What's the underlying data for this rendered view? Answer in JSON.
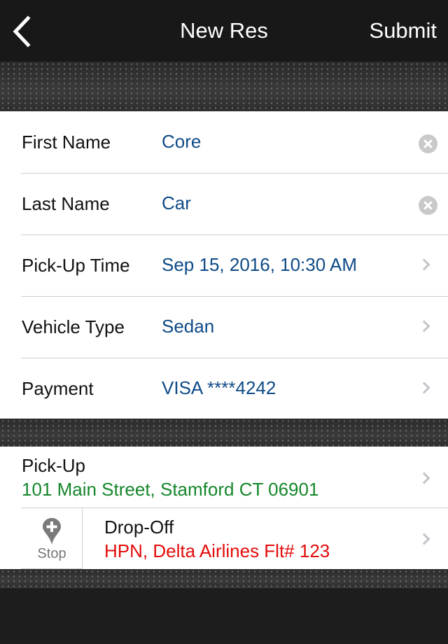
{
  "nav": {
    "title": "New Res",
    "submit_label": "Submit"
  },
  "details": [
    {
      "label": "First Name",
      "value": "Core",
      "action": "clear"
    },
    {
      "label": "Last Name",
      "value": "Car",
      "action": "clear"
    },
    {
      "label": "Pick-Up Time",
      "value": "Sep 15, 2016, 10:30 AM",
      "action": "chevron"
    },
    {
      "label": "Vehicle Type",
      "value": "Sedan",
      "action": "chevron"
    },
    {
      "label": "Payment",
      "value": "VISA ****4242",
      "action": "chevron"
    }
  ],
  "locations": {
    "pickup": {
      "title": "Pick-Up",
      "address": "101 Main Street, Stamford CT 06901"
    },
    "dropoff": {
      "title": "Drop-Off",
      "address": "HPN, Delta Airlines Flt# 123"
    },
    "stop_label": "Stop"
  },
  "colors": {
    "value": "#0e4a86",
    "pickup": "#14862a",
    "dropoff": "#e30b0b"
  }
}
